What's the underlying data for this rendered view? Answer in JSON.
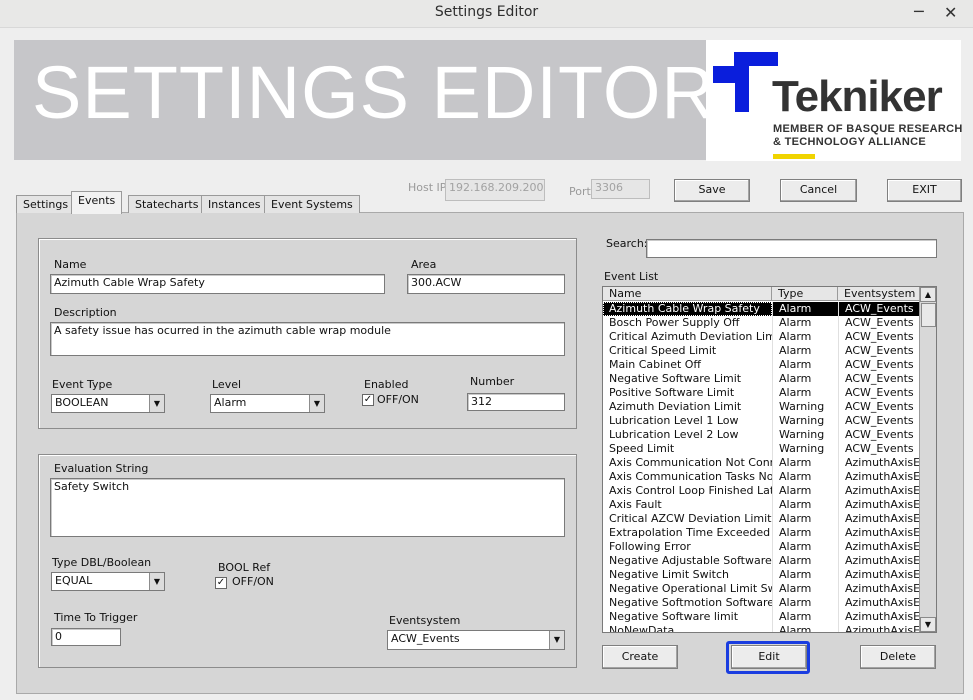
{
  "window": {
    "title": "Settings Editor",
    "minimize_glyph": "─",
    "close_glyph": "✕"
  },
  "banner": {
    "title": "SETTINGS EDITOR",
    "logo_name": "Tekniker",
    "logo_line1": "MEMBER OF BASQUE RESEARCH",
    "logo_line2": "& TECHNOLOGY ALLIANCE",
    "logo_color": "#0a1edc",
    "logo_accent": "#f0d400"
  },
  "tabs": [
    {
      "label": "Settings",
      "active": false
    },
    {
      "label": "Events",
      "active": true
    },
    {
      "label": "Statecharts",
      "active": false
    },
    {
      "label": "Instances",
      "active": false
    },
    {
      "label": "Event Systems",
      "active": false
    }
  ],
  "connection": {
    "host_label": "Host IP",
    "host_value": "192.168.209.200",
    "port_label": "Port",
    "port_value": "3306"
  },
  "toolbar": {
    "save": "Save",
    "cancel": "Cancel",
    "exit": "EXIT"
  },
  "event_form": {
    "name_label": "Name",
    "name_value": "Azimuth Cable Wrap Safety",
    "area_label": "Area",
    "area_value": "300.ACW",
    "description_label": "Description",
    "description_value": "A safety issue has ocurred in the azimuth cable wrap module",
    "event_type_label": "Event Type",
    "event_type_value": "BOOLEAN",
    "level_label": "Level",
    "level_value": "Alarm",
    "enabled_label": "Enabled",
    "enabled_check_label": "OFF/ON",
    "number_label": "Number",
    "number_value": "312"
  },
  "evaluation_form": {
    "eval_label": "Evaluation String",
    "eval_value": "Safety Switch",
    "type_label": "Type DBL/Boolean",
    "type_value": "EQUAL",
    "boolref_label": "BOOL Ref",
    "boolref_check_label": "OFF/ON",
    "ttt_label": "Time To Trigger",
    "ttt_value": "0",
    "eventsystem_label": "Eventsystem",
    "eventsystem_value": "ACW_Events"
  },
  "search": {
    "label": "Search:",
    "value": ""
  },
  "event_list": {
    "label": "Event List",
    "columns": [
      "Name",
      "Type",
      "Eventsystem"
    ],
    "rows": [
      [
        "Azimuth Cable Wrap Safety",
        "Alarm",
        "ACW_Events"
      ],
      [
        "Bosch Power Supply Off",
        "Alarm",
        "ACW_Events"
      ],
      [
        "Critical Azimuth Deviation Limit",
        "Alarm",
        "ACW_Events"
      ],
      [
        "Critical Speed Limit",
        "Alarm",
        "ACW_Events"
      ],
      [
        "Main Cabinet Off",
        "Alarm",
        "ACW_Events"
      ],
      [
        "Negative Software Limit",
        "Alarm",
        "ACW_Events"
      ],
      [
        "Positive Software Limit",
        "Alarm",
        "ACW_Events"
      ],
      [
        "Azimuth Deviation Limit",
        "Warning",
        "ACW_Events"
      ],
      [
        "Lubrication Level 1 Low",
        "Warning",
        "ACW_Events"
      ],
      [
        "Lubrication Level 2 Low",
        "Warning",
        "ACW_Events"
      ],
      [
        "Speed Limit",
        "Warning",
        "ACW_Events"
      ],
      [
        "Axis Communication Not Connect",
        "Alarm",
        "AzimuthAxisEve"
      ],
      [
        "Axis Communication Tasks Not Ru",
        "Alarm",
        "AzimuthAxisEve"
      ],
      [
        "Axis Control Loop Finished Late",
        "Alarm",
        "AzimuthAxisEve"
      ],
      [
        "Axis Fault",
        "Alarm",
        "AzimuthAxisEve"
      ],
      [
        "Critical AZCW Deviation Limit",
        "Alarm",
        "AzimuthAxisEve"
      ],
      [
        "Extrapolation Time Exceeded",
        "Alarm",
        "AzimuthAxisEve"
      ],
      [
        "Following Error",
        "Alarm",
        "AzimuthAxisEve"
      ],
      [
        "Negative Adjustable Software limit",
        "Alarm",
        "AzimuthAxisEve"
      ],
      [
        "Negative Limit Switch",
        "Alarm",
        "AzimuthAxisEve"
      ],
      [
        "Negative Operational Limit Switch",
        "Alarm",
        "AzimuthAxisEve"
      ],
      [
        "Negative Softmotion Software limi",
        "Alarm",
        "AzimuthAxisEve"
      ],
      [
        "Negative Software limit",
        "Alarm",
        "AzimuthAxisEve"
      ],
      [
        "NoNewData",
        "Alarm",
        "AzimuthAxisEve"
      ]
    ],
    "selected_index": 0
  },
  "list_buttons": {
    "create": "Create",
    "edit": "Edit",
    "delete": "Delete"
  },
  "focus_color": "#1a3de0"
}
